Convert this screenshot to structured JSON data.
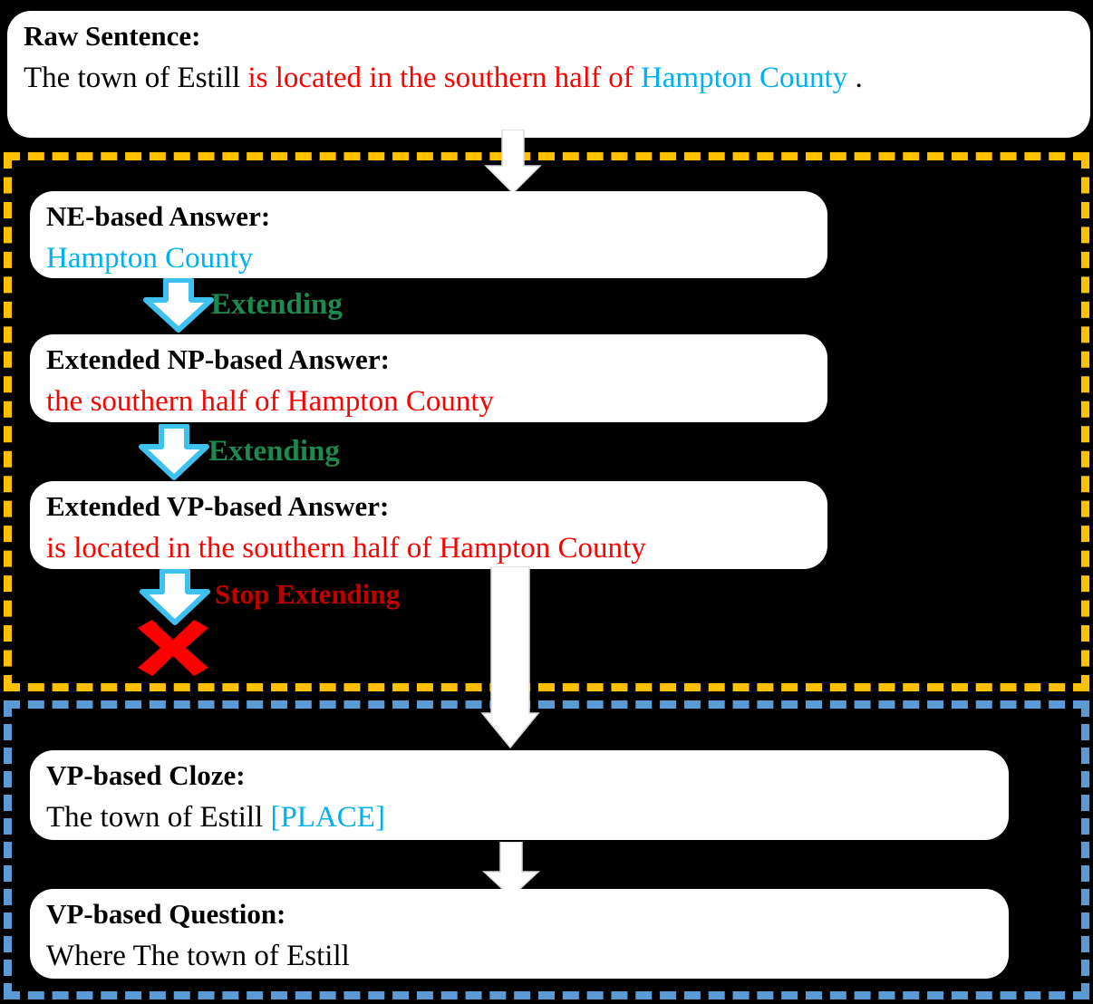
{
  "diagram": {
    "title": "Answer extension and question generation pipeline",
    "background_color": "#000000"
  },
  "colors": {
    "card_background": "#ffffff",
    "answer_red": "#ff0000",
    "entity_cyan": "#00b0f0",
    "extending_green": "#1c8a4e",
    "stop_dark_red": "#c00000",
    "frame_extract_orange": "#ffc000",
    "frame_generate_blue": "#5b9bd5",
    "arrow_white": "#ffffff",
    "arrow_outline_blue": "#3fc1f0",
    "cross_red": "#ff0000"
  },
  "raw_sentence_card": {
    "title": "Raw Sentence:",
    "segments": [
      {
        "text": "The town of Estill ",
        "color": "black"
      },
      {
        "text": "is located in the southern half of ",
        "color": "red"
      },
      {
        "text": "Hampton County",
        "color": "cyan"
      },
      {
        "text": " .",
        "color": "black"
      }
    ]
  },
  "extraction_group": {
    "frame_style": "dashed",
    "frame_color": "#ffc000",
    "cards": [
      {
        "name": "ne-based-answer",
        "title": "NE-based Answer:",
        "segments": [
          {
            "text": "Hampton County",
            "color": "cyan"
          }
        ]
      },
      {
        "name": "extended-np-based-answer",
        "title": "Extended NP-based Answer:",
        "segments": [
          {
            "text": "the southern half of Hampton County",
            "color": "red"
          }
        ]
      },
      {
        "name": "extended-vp-based-answer",
        "title": "Extended VP-based Answer:",
        "segments": [
          {
            "text": "is located in the southern half of Hampton County",
            "color": "red"
          }
        ]
      }
    ],
    "transition_labels": [
      {
        "name": "extending-1",
        "text": "Extending",
        "color": "#1c8a4e"
      },
      {
        "name": "extending-2",
        "text": "Extending",
        "color": "#1c8a4e"
      },
      {
        "name": "stop-extending",
        "text": "Stop Extending",
        "color": "#c00000"
      }
    ],
    "terminator_icon": "red-cross-icon"
  },
  "generation_group": {
    "frame_style": "dashed",
    "frame_color": "#5b9bd5",
    "cards": [
      {
        "name": "vp-based-cloze",
        "title": "VP-based Cloze:",
        "segments": [
          {
            "text": "The town of Estill ",
            "color": "black"
          },
          {
            "text": "[PLACE]",
            "color": "cyan"
          }
        ]
      },
      {
        "name": "vp-based-question",
        "title": "VP-based Question:",
        "segments": [
          {
            "text": "Where The town of Estill",
            "color": "black"
          }
        ]
      }
    ]
  },
  "flow_arrows": [
    {
      "name": "arrow-raw-to-ne",
      "direction": "down",
      "style": "white-block"
    },
    {
      "name": "arrow-vp-answer-to-cloze",
      "direction": "down",
      "style": "white-block-long"
    },
    {
      "name": "arrow-cloze-to-question",
      "direction": "down",
      "style": "white-block"
    }
  ]
}
